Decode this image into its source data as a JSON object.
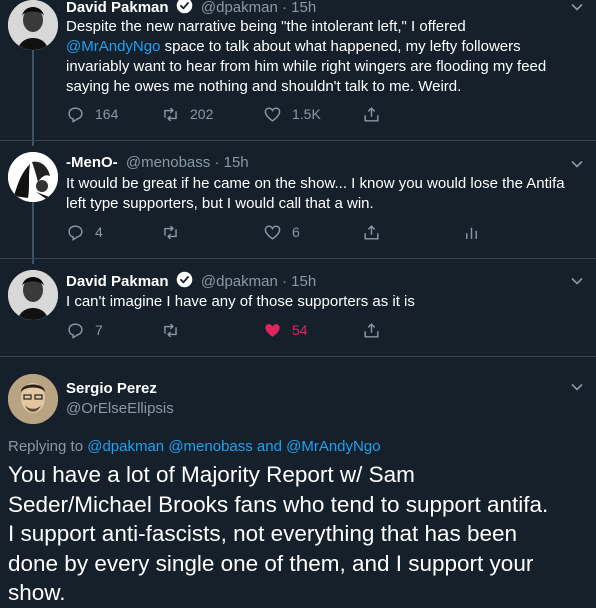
{
  "tweets": [
    {
      "name": "David Pakman",
      "handle": "@dpakman",
      "time": "· 15h",
      "text_lines": [
        "Despite the new narrative being \"the intolerant left,\" I offered",
        "space to talk about what happened, my lefty followers",
        "invariably want to hear from him while right wingers are flooding my feed",
        "saying he owes me nothing and shouldn't talk to me. Weird."
      ],
      "mention": "@MrAndyNgo",
      "replies": "164",
      "retweets": "202",
      "likes": "1.5K"
    },
    {
      "name": "-MenO-",
      "handle": "@menobass",
      "time": "· 15h",
      "text_lines": [
        "It would be great if he came on the show...  I know you would lose the Antifa",
        "left type supporters, but I would call that a win."
      ],
      "replies": "4",
      "retweets": "",
      "likes": "6"
    },
    {
      "name": "David Pakman",
      "handle": "@dpakman",
      "time": "· 15h",
      "text_lines": [
        "I can't imagine I have any of those supporters as it is"
      ],
      "replies": "7",
      "retweets": "",
      "likes": "54"
    }
  ],
  "focused": {
    "name": "Sergio Perez",
    "handle": "@OrElseEllipsis",
    "replying_prefix": "Replying to",
    "replying_to": "@dpakman @menobass and @MrAndyNgo",
    "text_lines": [
      "You have a lot of Majority Report w/ Sam",
      "Seder/Michael Brooks fans who tend to support antifa.",
      "I support anti-fascists, not everything that has been",
      "done by every single one of them, and I support your",
      "show."
    ]
  },
  "colors": {
    "background": "#15202b",
    "accent": "#1da1f2",
    "secondary": "#8899a6",
    "like": "#e0245e"
  }
}
